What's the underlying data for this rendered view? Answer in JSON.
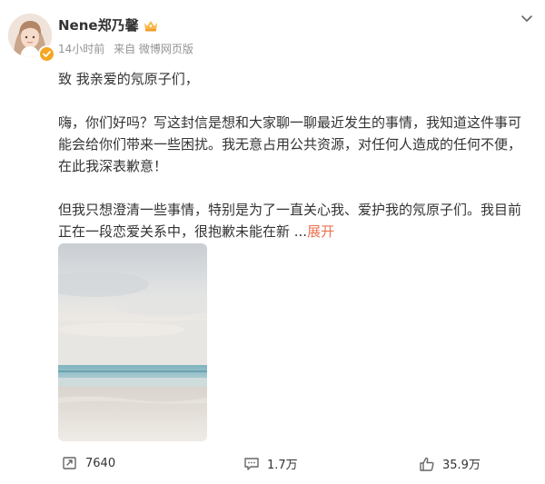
{
  "post": {
    "author": {
      "name": "Nene郑乃馨",
      "verified_icon": "verified-badge-icon",
      "vip_icon": "vip-crown-icon"
    },
    "meta": {
      "time": "14小时前",
      "source": "来自 微博网页版"
    },
    "content": {
      "greeting": "致 我亲爱的氖原子们，",
      "paragraph1": "嗨，你们好吗？写这封信是想和大家聊一聊最近发生的事情，我知道这件事可能会给你们带来一些困扰。我无意占用公共资源，对任何人造成的任何不便，在此我深表歉意！",
      "paragraph2": "但我只想澄清一些事情，特别是为了一直关心我、爱护我的氖原子们。我目前正在一段恋爱关系中，很抱歉未能在新 ...",
      "expand_label": "展开"
    },
    "image": {
      "icon": "seascape-photo"
    },
    "actions": {
      "repost_count": "7640",
      "comment_count": "1.7万",
      "like_count": "35.9万"
    }
  }
}
